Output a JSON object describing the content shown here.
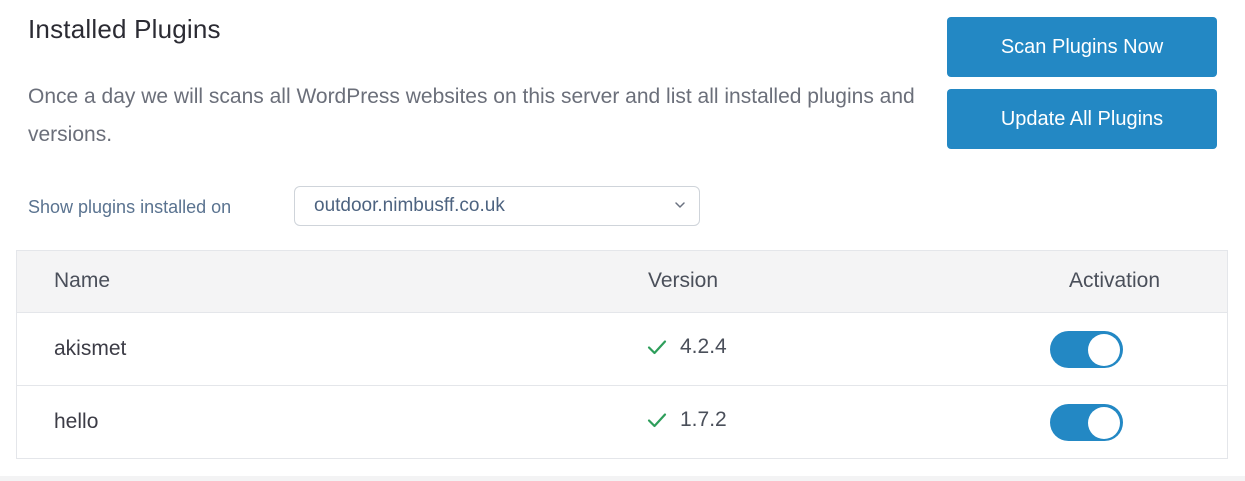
{
  "header": {
    "title": "Installed Plugins",
    "description": "Once a day we will scans all WordPress websites on this server and list all installed plugins and versions."
  },
  "actions": {
    "scan_label": "Scan Plugins Now",
    "update_label": "Update All Plugins"
  },
  "filter": {
    "label": "Show plugins installed on",
    "selected": "outdoor.nimbusff.co.uk"
  },
  "table": {
    "columns": [
      "Name",
      "Version",
      "Activation"
    ],
    "rows": [
      {
        "name": "akismet",
        "version": "4.2.4",
        "active": true
      },
      {
        "name": "hello",
        "version": "1.7.2",
        "active": true
      }
    ]
  },
  "colors": {
    "accent": "#2388c4",
    "check": "#2e9e5b"
  },
  "icons": {
    "version_status": "check-icon",
    "select": "chevron-down-icon"
  }
}
